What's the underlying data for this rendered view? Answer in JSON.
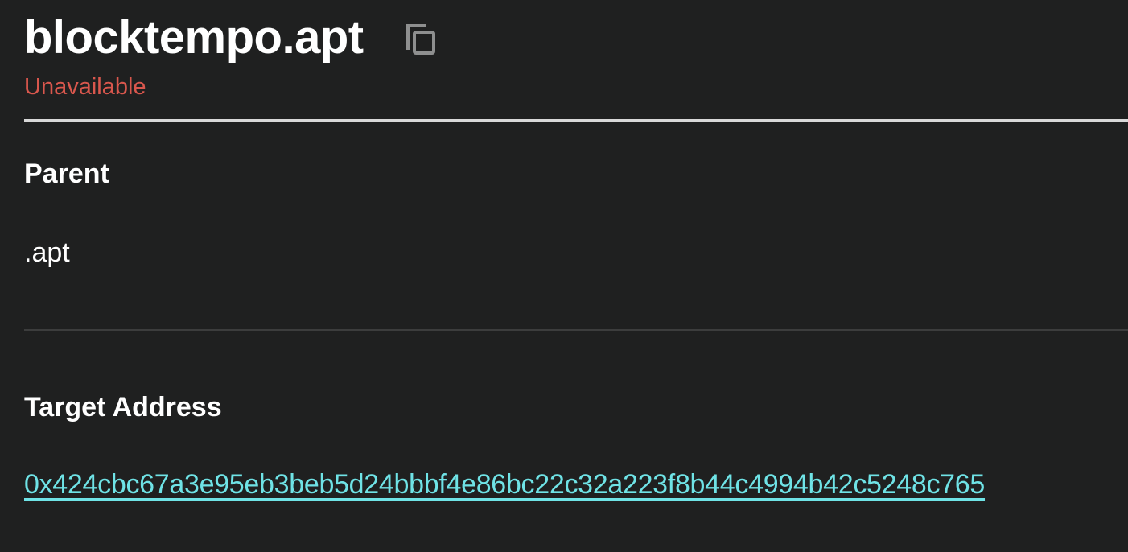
{
  "header": {
    "domain_name": "blocktempo.apt",
    "copy_icon": "copy-icon",
    "status": "Unavailable"
  },
  "parent": {
    "label": "Parent",
    "value": ".apt"
  },
  "target_address": {
    "label": "Target Address",
    "value": "0x424cbc67a3e95eb3beb5d24bbbf4e86bc22c32a223f8b44c4994b42c5248c765"
  },
  "colors": {
    "background": "#1f2020",
    "status_unavailable": "#d9574d",
    "link": "#6fe3e6",
    "text": "#ffffff"
  }
}
